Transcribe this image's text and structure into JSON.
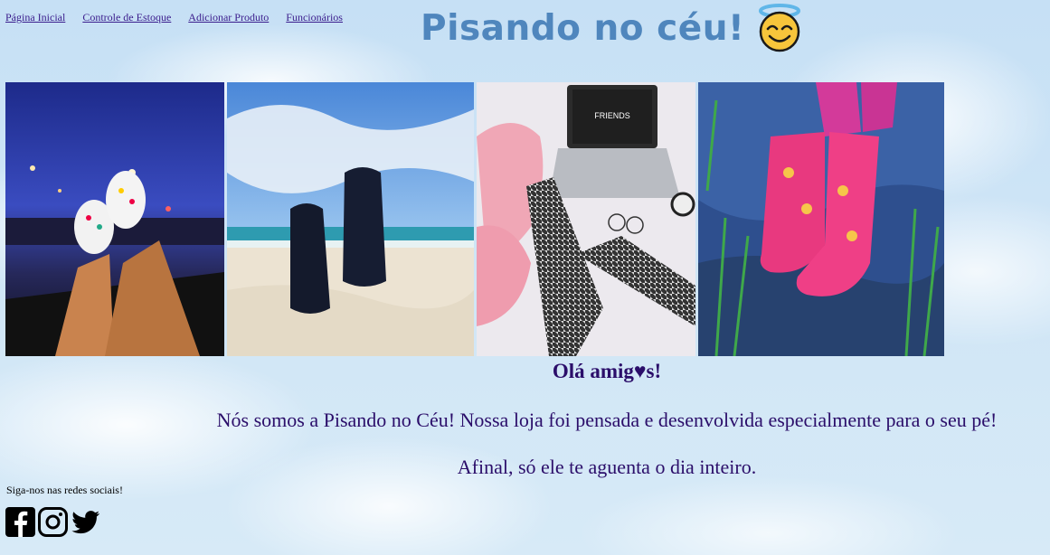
{
  "nav": {
    "items": [
      "Página Inicial",
      "Controle de Estoque",
      "Adicionar Produto",
      "Funcionários"
    ]
  },
  "header": {
    "title": "Pisando no céu!",
    "emoji": "smiling-face-with-halo"
  },
  "gallery": {
    "photos": [
      {
        "subject": "crocs-in-car-at-night"
      },
      {
        "subject": "flip-flops-on-beach"
      },
      {
        "subject": "houndstooth-leggings-pink-slippers-laptop"
      },
      {
        "subject": "pink-rain-boots-in-puddle"
      }
    ],
    "laptop_sticker": "FRIENDS"
  },
  "main": {
    "greeting": "Olá amig♥s!",
    "paragraph1": "Nós somos a Pisando no Céu! Nossa loja foi pensada e desenvolvida especialmente para o seu pé!",
    "paragraph2": "Afinal, só ele te aguenta o dia inteiro."
  },
  "social": {
    "label": "Siga-nos nas redes sociais!",
    "icons": [
      "facebook-icon",
      "instagram-icon",
      "twitter-icon"
    ]
  },
  "colors": {
    "title": "#4f86bd",
    "body_text": "#2b0e6a",
    "nav_link": "#3a1c8c",
    "sky": "#cfe5f6"
  }
}
